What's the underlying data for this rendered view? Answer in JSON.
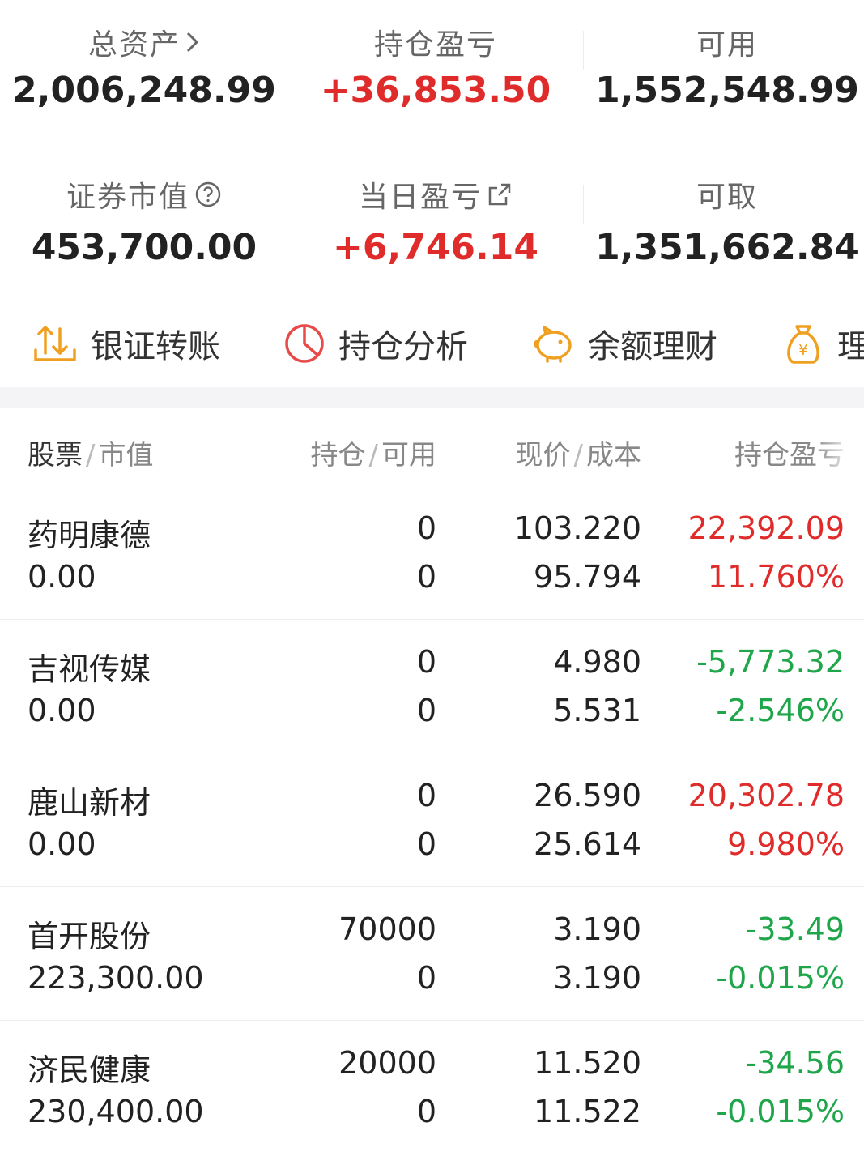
{
  "summary": {
    "total_assets": {
      "label": "总资产",
      "value": "2,006,248.99"
    },
    "position_pl": {
      "label": "持仓盈亏",
      "value": "+36,853.50",
      "color": "#e02b2b"
    },
    "available": {
      "label": "可用",
      "value": "1,552,548.99"
    },
    "market_value": {
      "label": "证券市值",
      "value": "453,700.00"
    },
    "daily_pl": {
      "label": "当日盈亏",
      "value": "+6,746.14",
      "color": "#e02b2b"
    },
    "withdrawable": {
      "label": "可取",
      "value": "1,351,662.84"
    }
  },
  "actions": [
    {
      "label": "银证转账",
      "icon": "transfer-icon"
    },
    {
      "label": "持仓分析",
      "icon": "pie-chart-icon"
    },
    {
      "label": "余额理财",
      "icon": "piggy-bank-icon"
    },
    {
      "label": "理",
      "icon": "money-bag-icon"
    }
  ],
  "table": {
    "headers": {
      "stock": "股票",
      "market_value": "市值",
      "position": "持仓",
      "available": "可用",
      "price": "现价",
      "cost": "成本",
      "pl": "持仓盈亏"
    },
    "rows": [
      {
        "name": "药明康德",
        "market_value": "0.00",
        "position": "0",
        "available": "0",
        "price": "103.220",
        "cost": "95.794",
        "pl": "22,392.09",
        "pl_pct": "11.760%",
        "trend": "up"
      },
      {
        "name": "吉视传媒",
        "market_value": "0.00",
        "position": "0",
        "available": "0",
        "price": "4.980",
        "cost": "5.531",
        "pl": "-5,773.32",
        "pl_pct": "-2.546%",
        "trend": "down"
      },
      {
        "name": "鹿山新材",
        "market_value": "0.00",
        "position": "0",
        "available": "0",
        "price": "26.590",
        "cost": "25.614",
        "pl": "20,302.78",
        "pl_pct": "9.980%",
        "trend": "up"
      },
      {
        "name": "首开股份",
        "market_value": "223,300.00",
        "position": "70000",
        "available": "0",
        "price": "3.190",
        "cost": "3.190",
        "pl": "-33.49",
        "pl_pct": "-0.015%",
        "trend": "down"
      },
      {
        "name": "济民健康",
        "market_value": "230,400.00",
        "position": "20000",
        "available": "0",
        "price": "11.520",
        "cost": "11.522",
        "pl": "-34.56",
        "pl_pct": "-0.015%",
        "trend": "down"
      }
    ]
  },
  "colors": {
    "up": "#e02b2b",
    "down": "#1fa64a",
    "icon_orange": "#f0a020",
    "icon_red": "#e84a4a"
  }
}
